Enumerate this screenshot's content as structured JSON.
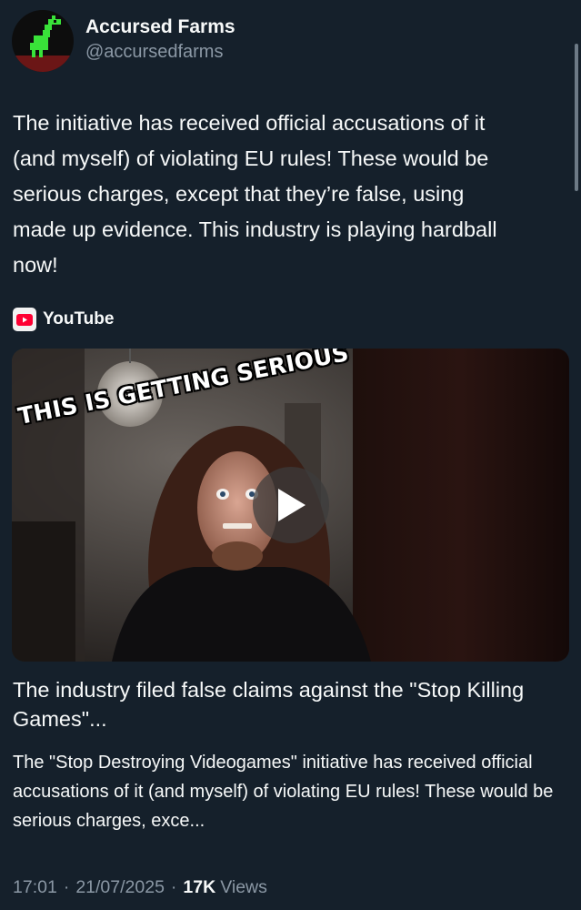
{
  "author": {
    "display_name": "Accursed Farms",
    "handle": "@accursedfarms",
    "avatar_icon": "pixel-horse-avatar-icon"
  },
  "tweet": {
    "text": "The initiative has received official accusations of it\n(and myself) of violating EU rules! These would be\nserious charges, except that they’re false, using\nmade up evidence. This industry is playing hardball\nnow!"
  },
  "link_card": {
    "source_icon": "youtube-icon",
    "source_label": "YouTube",
    "thumbnail_overlay_text": "THIS IS GETTING SERIOUS",
    "play_icon": "play-icon",
    "title": "The industry filed false claims against the \"Stop Killing Games\"...",
    "description": "The \"Stop Destroying Videogames\" initiative has received official accusations of it (and myself) of violating EU rules! These would be serious charges, exce..."
  },
  "meta": {
    "time": "17:01",
    "separator": "·",
    "date": "21/07/2025",
    "views_count": "17K",
    "views_label": "Views"
  },
  "colors": {
    "background": "#15202b",
    "primary_text": "#f7f9f9",
    "secondary_text": "#8b98a5",
    "youtube_red": "#ff0033"
  }
}
